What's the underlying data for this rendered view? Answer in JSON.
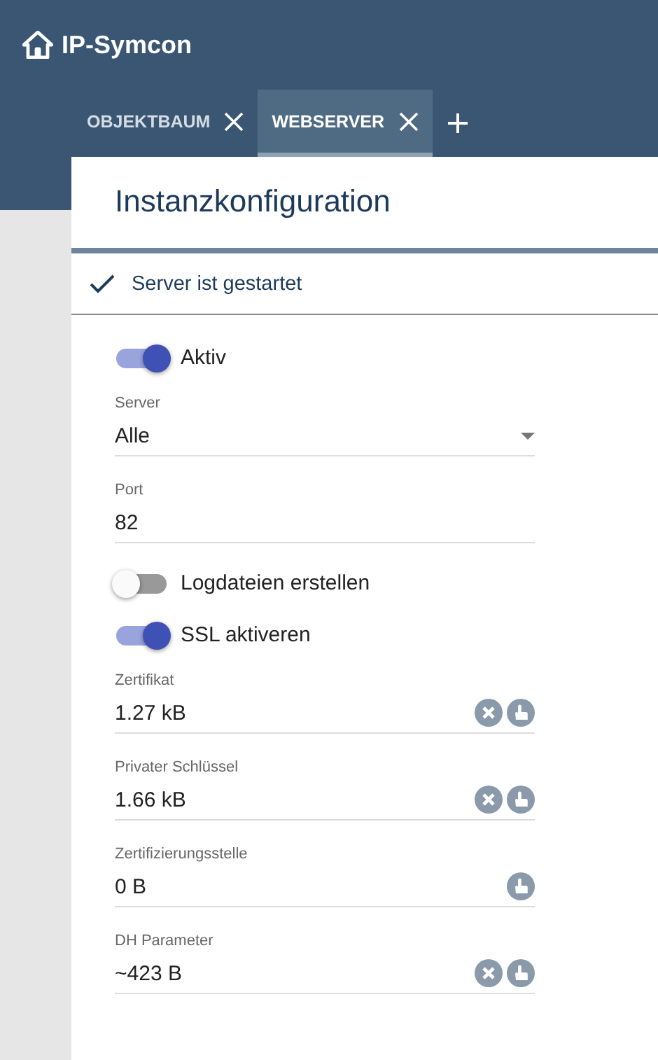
{
  "app": {
    "title": "IP-Symcon"
  },
  "tabs": [
    {
      "label": "OBJEKTBAUM",
      "selected": false
    },
    {
      "label": "WEBSERVER",
      "selected": true
    }
  ],
  "panel": {
    "title": "Instanzkonfiguration",
    "status": "Server ist gestartet"
  },
  "form": [
    {
      "kind": "switch",
      "label": "Aktiv",
      "on": true
    },
    {
      "kind": "select",
      "label": "Server",
      "value": "Alle"
    },
    {
      "kind": "text",
      "label": "Port",
      "value": "82"
    },
    {
      "kind": "switch",
      "label": "Logdateien erstellen",
      "on": false
    },
    {
      "kind": "switch",
      "label": "SSL aktiveren",
      "on": true
    },
    {
      "kind": "file",
      "label": "Zertifikat",
      "value": "1.27 kB",
      "clearable": true
    },
    {
      "kind": "file",
      "label": "Privater Schlüssel",
      "value": "1.66 kB",
      "clearable": true
    },
    {
      "kind": "file",
      "label": "Zertifizierungsstelle",
      "value": "0 B",
      "clearable": false
    },
    {
      "kind": "file",
      "label": "DH Parameter",
      "value": "~423 B",
      "clearable": true
    }
  ]
}
